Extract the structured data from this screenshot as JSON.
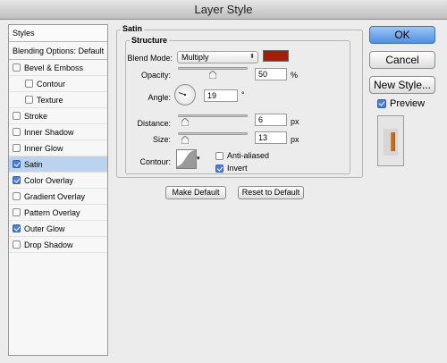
{
  "window": {
    "title": "Layer Style"
  },
  "styles_panel": {
    "header": "Styles",
    "blending_options": "Blending Options: Default",
    "items": [
      {
        "label": "Bevel & Emboss",
        "checked": false,
        "indent": false,
        "selected": false
      },
      {
        "label": "Contour",
        "checked": false,
        "indent": true,
        "selected": false
      },
      {
        "label": "Texture",
        "checked": false,
        "indent": true,
        "selected": false
      },
      {
        "label": "Stroke",
        "checked": false,
        "indent": false,
        "selected": false
      },
      {
        "label": "Inner Shadow",
        "checked": false,
        "indent": false,
        "selected": false
      },
      {
        "label": "Inner Glow",
        "checked": false,
        "indent": false,
        "selected": false
      },
      {
        "label": "Satin",
        "checked": true,
        "indent": false,
        "selected": true
      },
      {
        "label": "Color Overlay",
        "checked": true,
        "indent": false,
        "selected": false
      },
      {
        "label": "Gradient Overlay",
        "checked": false,
        "indent": false,
        "selected": false
      },
      {
        "label": "Pattern Overlay",
        "checked": false,
        "indent": false,
        "selected": false
      },
      {
        "label": "Outer Glow",
        "checked": true,
        "indent": false,
        "selected": false
      },
      {
        "label": "Drop Shadow",
        "checked": false,
        "indent": false,
        "selected": false
      }
    ]
  },
  "satin": {
    "group_title": "Satin",
    "structure_title": "Structure",
    "blend_mode_label": "Blend Mode:",
    "blend_mode_value": "Multiply",
    "color": "#a21e06",
    "opacity_label": "Opacity:",
    "opacity_value": "50",
    "opacity_unit": "%",
    "opacity_level": 0.5,
    "angle_label": "Angle:",
    "angle_value": "19",
    "angle_unit": "°",
    "distance_label": "Distance:",
    "distance_value": "6",
    "distance_unit": "px",
    "distance_level": 0.06,
    "size_label": "Size:",
    "size_value": "13",
    "size_unit": "px",
    "size_level": 0.05,
    "contour_label": "Contour:",
    "anti_aliased_label": "Anti-aliased",
    "anti_aliased_checked": false,
    "invert_label": "Invert",
    "invert_checked": true,
    "make_default_label": "Make Default",
    "reset_default_label": "Reset to Default"
  },
  "actions": {
    "ok_label": "OK",
    "cancel_label": "Cancel",
    "new_style_label": "New Style...",
    "preview_label": "Preview",
    "preview_checked": true
  },
  "icons": {
    "dropdown": "chevron-updown-icon",
    "checkbox": "checkmark-icon",
    "slider_thumb": "triangle-thumb-icon"
  },
  "colors": {
    "accent": "#4f8fe2",
    "selection": "#bcd3f0",
    "preview_bar": "#e07a1a"
  }
}
